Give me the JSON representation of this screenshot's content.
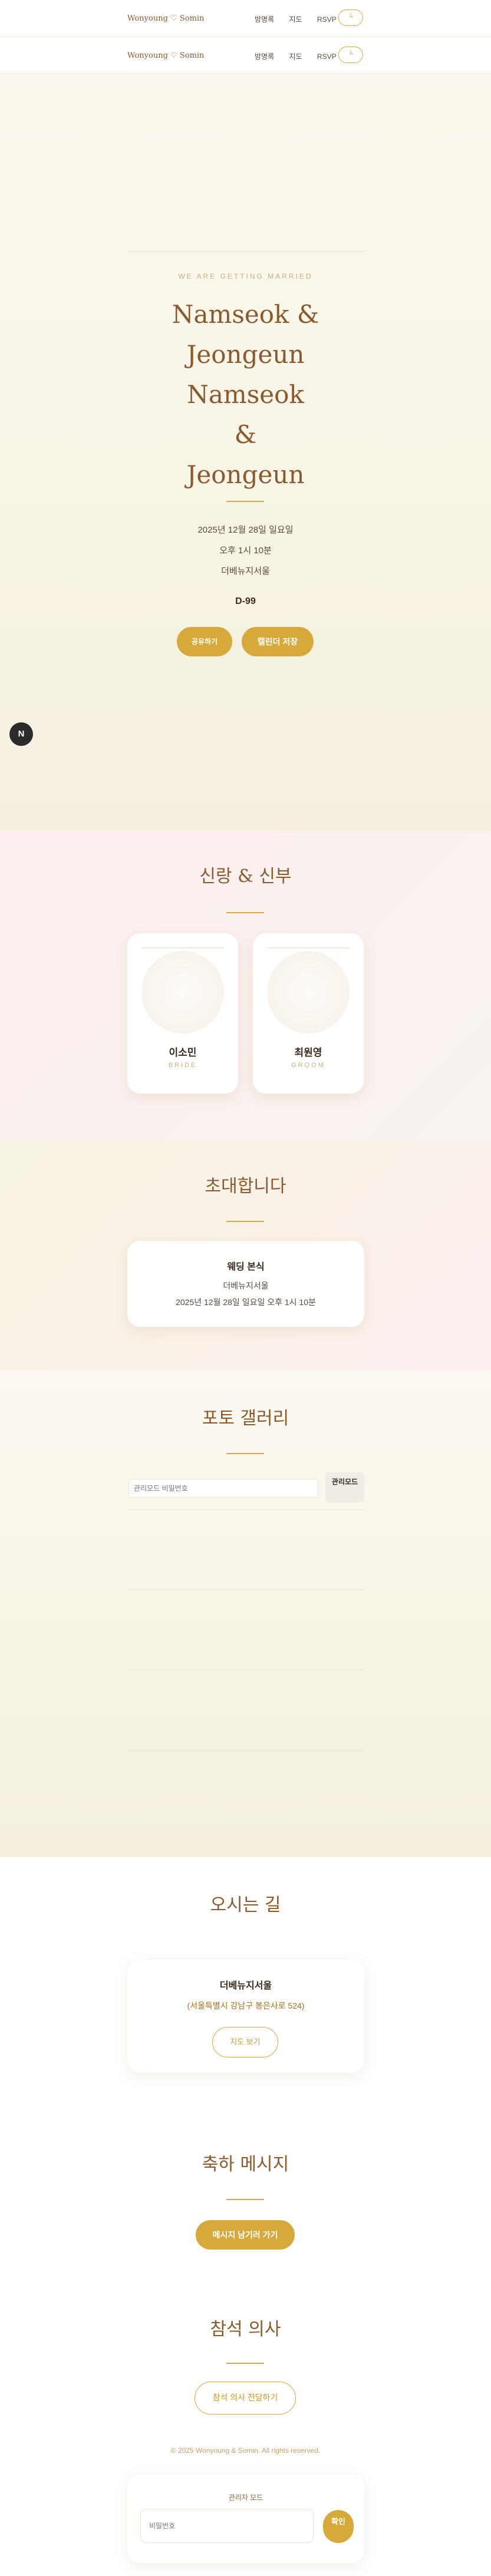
{
  "nav": {
    "brand": "Wonyoung ♡ Somin",
    "links": [
      "방명록",
      "지도",
      "RSVP"
    ],
    "toggle": "└"
  },
  "hero": {
    "tagline": "WE ARE GETTING MARRIED",
    "title_lines": [
      "Namseok &",
      "Jeongeun",
      "Namseok",
      "&",
      "Jeongeun"
    ],
    "date": "2025년 12월 28일 일요일",
    "time": "오후 1시 10분",
    "venue": "더베뉴지서울",
    "dday": "D-99",
    "share_label": "공유하기",
    "calendar_label": "캘린더 저장",
    "float_badge": "N"
  },
  "couple": {
    "title": "신랑 & 신부",
    "people": [
      {
        "name": "이소민",
        "role": "BRIDE"
      },
      {
        "name": "최원영",
        "role": "GROOM"
      }
    ]
  },
  "invite": {
    "title": "초대합니다",
    "event_title": "웨딩 본식",
    "venue": "더베뉴지서울",
    "datetime": "2025년 12월 28일 일요일 오후 1시 10분"
  },
  "gallery": {
    "title": "포토 갤러리",
    "password_placeholder": "관리모드 비밀번호",
    "admin_button": "관리모드"
  },
  "directions": {
    "title": "오시는 길",
    "venue": "더베뉴지서울",
    "address": "(서울특별시 강남구 봉은사로 524)",
    "map_button": "지도 보기"
  },
  "guestbook": {
    "title": "축하 메시지",
    "button": "메시지 남기러 가기"
  },
  "rsvp": {
    "title": "참석 의사",
    "button": "참석 의사 전달하기"
  },
  "footer": {
    "copyright": "© 2025 Wonyoung & Somin. All rights reserved.",
    "admin_title": "관리자 모드",
    "password_placeholder": "비밀번호",
    "confirm_button": "확인"
  },
  "colors": {
    "gold": "#d7a93b",
    "brown": "#8a5a2b",
    "pink_bg": "#fcf1f1",
    "cream_bg": "#f7f3e2"
  }
}
